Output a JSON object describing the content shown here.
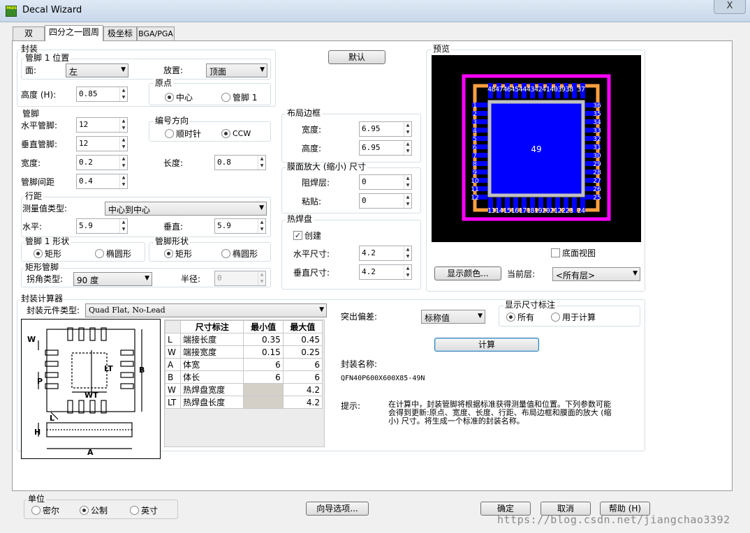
{
  "window": {
    "title": "Decal Wizard",
    "close": "X",
    "icon_text": "PADS"
  },
  "tabs": [
    "双",
    "四分之一圆周",
    "极坐标",
    "BGA/PGA"
  ],
  "package": {
    "title": "封装",
    "pin1": {
      "title": "管脚 1 位置",
      "side_label": "面:",
      "side_value": "左",
      "place_label": "放置:",
      "place_value": "顶面"
    },
    "height_label": "高度 (H):",
    "height_value": "0.85",
    "origin": {
      "title": "原点",
      "center": "中心",
      "pin1": "管脚 1"
    }
  },
  "pins": {
    "title": "管脚",
    "hpins_label": "水平管脚:",
    "hpins_value": "12",
    "vpins_label": "垂直管脚:",
    "vpins_value": "12",
    "width_label": "宽度:",
    "width_value": "0.2",
    "length_label": "长度:",
    "length_value": "0.8",
    "pitch_label": "管脚间距",
    "pitch_value": "0.4",
    "numbering": {
      "title": "编号方向",
      "cw": "顺时针",
      "ccw": "CCW"
    }
  },
  "row_spacing": {
    "title": "行距",
    "measure_label": "测量值类型:",
    "measure_value": "中心到中心",
    "horiz_label": "水平:",
    "horiz_value": "5.9",
    "vert_label": "垂直:",
    "vert_value": "5.9"
  },
  "pin1_shape": {
    "title": "管脚 1 形状",
    "rect": "矩形",
    "oval": "椭圆形"
  },
  "pin_shape": {
    "title": "管脚形状",
    "rect": "矩形",
    "oval": "椭圆形"
  },
  "rect_pin": {
    "title": "矩形管脚",
    "corner_label": "拐角类型:",
    "corner_value": "90 度",
    "radius_label": "半径:",
    "radius_value": "0"
  },
  "default_button": "默认",
  "layout_border": {
    "title": "布局边框",
    "width_label": "宽度:",
    "width_value": "6.95",
    "height_label": "高度:",
    "height_value": "6.95"
  },
  "mask": {
    "title": "膜面放大 (缩小) 尺寸",
    "solder_label": "阻焊层:",
    "solder_value": "0",
    "paste_label": "粘贴:",
    "paste_value": "0"
  },
  "thermal": {
    "title": "热焊盘",
    "create_label": "创建",
    "hsize_label": "水平尺寸:",
    "hsize_value": "4.2",
    "vsize_label": "垂直尺寸:",
    "vsize_value": "4.2"
  },
  "preview": {
    "title": "预览",
    "center_num": "49",
    "top_nums": "4847464544434241403938 37",
    "bottom_nums": "1314151617181920212223 24",
    "left_nums": [
      "1",
      "2",
      "3",
      "4",
      "5",
      "6",
      "7",
      "8",
      "9",
      "10",
      "11",
      "12"
    ],
    "right_nums": [
      "36",
      "35",
      "34",
      "33",
      "32",
      "31",
      "30",
      "29",
      "28",
      "27",
      "26",
      "25"
    ],
    "bottom_view": "底面视图",
    "show_colors": "显示颜色...",
    "current_layer_label": "当前层:",
    "current_layer_value": "<所有层>",
    "colors": {
      "bg": "#000000",
      "outline": "#ff00ff",
      "pad": "#0000ff",
      "body": "#ffa040",
      "thermal": "#0000ff",
      "thermal_border": "#c0c0c0"
    }
  },
  "calc": {
    "title": "封装计算器",
    "type_label": "封装元件类型:",
    "type_value": "Quad Flat, No-Lead",
    "diagram": {
      "W": "W",
      "P": "P",
      "LT": "LT",
      "WT": "WT",
      "B": "B",
      "L": "L",
      "H": "H",
      "A": "A"
    },
    "table": {
      "headers": [
        "尺寸标注",
        "最小值",
        "最大值"
      ],
      "rows": [
        {
          "k": "L",
          "name": "端接长度",
          "min": "0.35",
          "max": "0.45"
        },
        {
          "k": "W",
          "name": "端接宽度",
          "min": "0.15",
          "max": "0.25"
        },
        {
          "k": "A",
          "name": "体宽",
          "min": "6",
          "max": "6"
        },
        {
          "k": "B",
          "name": "体长",
          "min": "6",
          "max": "6"
        },
        {
          "k": "W",
          "name": "热焊盘宽度",
          "min": "",
          "max": "4.2"
        },
        {
          "k": "LT",
          "name": "热焊盘长度",
          "min": "",
          "max": "4.2"
        }
      ]
    },
    "tolerance_label": "突出偏差:",
    "tolerance_value": "标称值",
    "show_dims": {
      "title": "显示尺寸标注",
      "all": "所有",
      "calc": "用于计算"
    },
    "calc_button": "计算",
    "name_label": "封装名称:",
    "name_value": "QFN40P600X600X85-49N",
    "hint_label": "提示:",
    "hint_line1": "在计算中，封装管脚将根据标准获得测量值和位置。下列参数可能",
    "hint_line2": "会得到更新:原点、宽度、长度、行距、布局边框和膜面的放大 (缩",
    "hint_line3": "小) 尺寸。将生成一个标准的封装名称。"
  },
  "units": {
    "title": "单位",
    "mil": "密尔",
    "metric": "公制",
    "inch": "英寸"
  },
  "bottom_buttons": {
    "wizard_options": "向导选项...",
    "ok": "确定",
    "cancel": "取消",
    "help": "帮助 (H)"
  },
  "watermark": "https://blog.csdn.net/jiangchao3392"
}
